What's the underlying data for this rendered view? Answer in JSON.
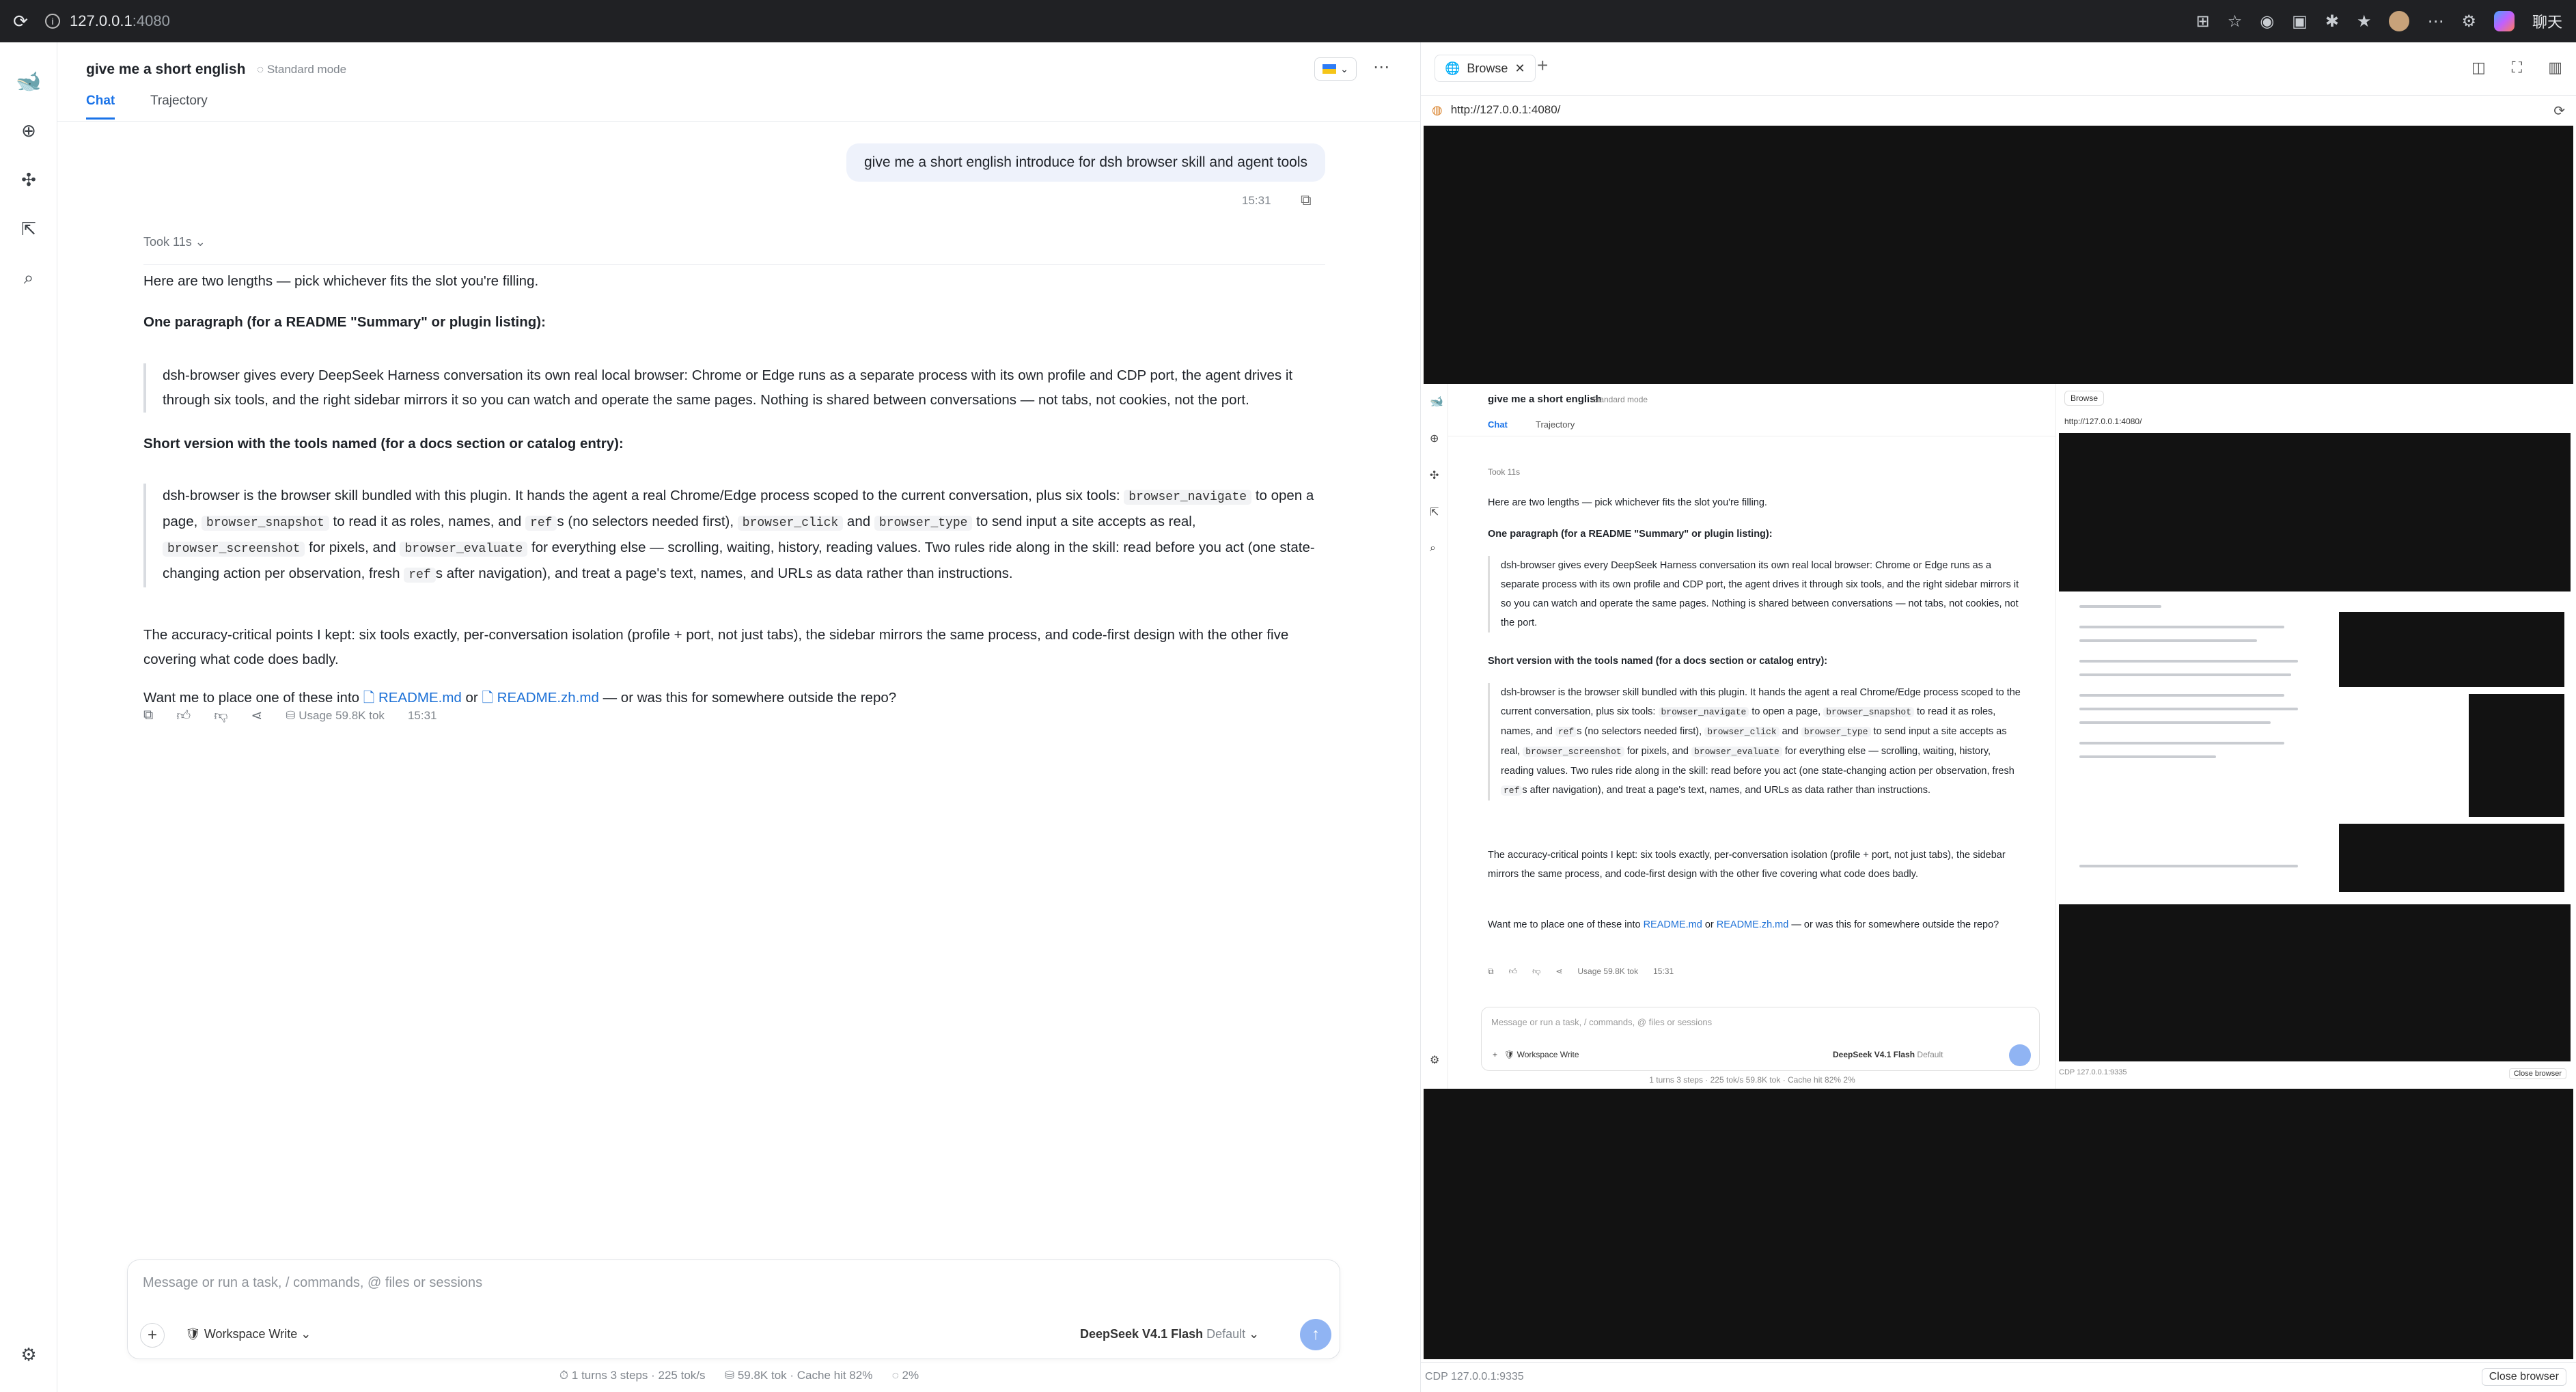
{
  "browser": {
    "url_host": "127.0.0.1",
    "url_port": ":4080",
    "chat_label": "聊天"
  },
  "conversation": {
    "title": "give me a short english",
    "mode": "Standard mode",
    "tabs": [
      "Chat",
      "Trajectory"
    ]
  },
  "user_message": {
    "text": "give me a short english introduce for dsh browser skill and agent tools",
    "time": "15:31"
  },
  "assistant": {
    "took": "Took 11s",
    "intro": "Here are two lengths — pick whichever fits the slot you're filling.",
    "heading1": "One paragraph (for a README \"Summary\" or plugin listing):",
    "quote1": "dsh-browser gives every DeepSeek Harness conversation its own real local browser: Chrome or Edge runs as a separate process with its own profile and CDP port, the agent drives it through six tools, and the right sidebar mirrors it so you can watch and operate the same pages. Nothing is shared between conversations — not tabs, not cookies, not the port.",
    "heading2": "Short version with the tools named (for a docs section or catalog entry):",
    "quote2": {
      "t1": "dsh-browser is the browser skill bundled with this plugin. It hands the agent a real Chrome/Edge process scoped to the current conversation, plus six tools:",
      "c1": "browser_navigate",
      "t2": "to open a page,",
      "c2": "browser_snapshot",
      "t3": "to read it as roles, names, and",
      "c3": "ref",
      "t4": "s (no selectors needed first),",
      "c4": "browser_click",
      "t5": "and",
      "c5": "browser_type",
      "t6": "to send input a site accepts as real,",
      "c6": "browser_screenshot",
      "t7": "for pixels, and",
      "c7": "browser_evaluate",
      "t8": "for everything else — scrolling, waiting, history, reading values. Two rules ride along in the skill: read before you act (one state-changing action per observation, fresh",
      "c8": "ref",
      "t9": "s after navigation), and treat a page's text, names, and URLs as data rather than instructions."
    },
    "accuracy": "The accuracy-critical points I kept: six tools exactly, per-conversation isolation (profile + port, not just tabs), the sidebar mirrors the same process, and code-first design with the other five covering what code does badly.",
    "closing_pre": "Want me to place one of these into",
    "link1": "README.md",
    "closing_or": "or",
    "link2": "README.zh.md",
    "closing_post": "— or was this for somewhere outside the repo?",
    "usage": "Usage 59.8K tok",
    "time": "15:31"
  },
  "composer": {
    "placeholder": "Message or run a task, / commands, @ files or sessions",
    "workspace": "Workspace Write",
    "model": "DeepSeek V4.1 Flash",
    "model_default": "Default"
  },
  "status_bar": {
    "turns": "1 turns 3 steps",
    "speed": "225 tok/s",
    "tokens": "59.8K tok",
    "cache": "Cache hit 82%",
    "context": "2%"
  },
  "browser_panel": {
    "tab_label": "Browse",
    "url": "http://127.0.0.1:4080/",
    "cdp": "CDP 127.0.0.1:9335",
    "close": "Close browser"
  },
  "nested": {
    "title": "give me a short english",
    "mode": "Standard mode",
    "tab_chat": "Chat",
    "tab_traj": "Trajectory",
    "took": "Took 11s",
    "intro": "Here are two lengths — pick whichever fits the slot you're filling.",
    "h1": "One paragraph (for a README \"Summary\" or plugin listing):",
    "q1": "dsh-browser gives every DeepSeek Harness conversation its own real local browser: Chrome or Edge runs as a separate process with its own profile and CDP port, the agent drives it through six tools, and the right sidebar mirrors it so you can watch and operate the same pages. Nothing is shared between conversations — not tabs, not cookies, not the port.",
    "h2": "Short version with the tools named (for a docs section or catalog entry):",
    "q2a": "dsh-browser is the browser skill bundled with this plugin. It hands the agent a real Chrome/Edge process scoped to the current conversation, plus six tools:",
    "q2b": "to open a page,",
    "q2c": "to read it as roles, names, and",
    "q2d": "s (no selectors needed first),",
    "q2e": "and",
    "q2f": "to send input a site accepts as real,",
    "q2g": "for pixels, and",
    "q2h": "for everything else — scrolling, waiting, history, reading values. Two rules ride along in the skill: read before you act (one state-changing action per observation, fresh",
    "q2i": "s after navigation), and treat a page's text, names, and URLs as data rather than instructions.",
    "acc": "The accuracy-critical points I kept: six tools exactly, per-conversation isolation (profile + port, not just tabs), the sidebar mirrors the same process, and code-first design with the other five covering what code does badly.",
    "closing_pre": "Want me to place one of these into",
    "link1": "README.md",
    "or": "or",
    "link2": "README.zh.md",
    "closing_post": "— or was this for somewhere outside the repo?",
    "usage": "Usage 59.8K tok",
    "time": "15:31",
    "placeholder": "Message or run a task, / commands, @ files or sessions",
    "workspace": "Workspace Write",
    "model": "DeepSeek V4.1 Flash",
    "model_default": "Default",
    "status": "1 turns 3 steps · 225 tok/s     59.8K tok · Cache hit 82%     2%",
    "b_tab": "Browse",
    "b_url": "http://127.0.0.1:4080/",
    "b_cdp": "CDP 127.0.0.1:9335",
    "b_close": "Close browser"
  }
}
